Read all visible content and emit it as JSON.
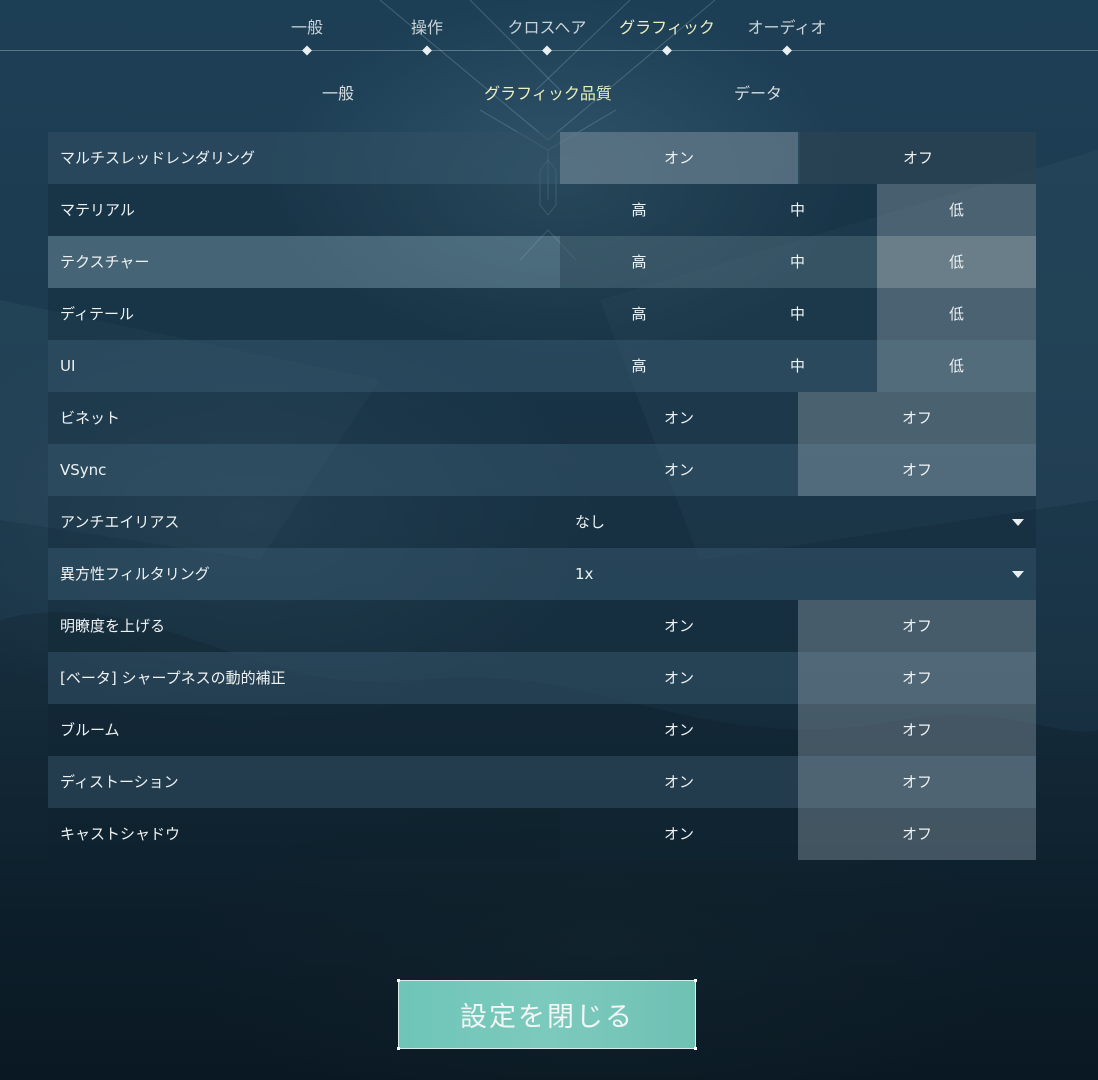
{
  "top_tabs": [
    {
      "label": "一般",
      "active": false
    },
    {
      "label": "操作",
      "active": false
    },
    {
      "label": "クロスヘア",
      "active": false
    },
    {
      "label": "グラフィック",
      "active": true
    },
    {
      "label": "オーディオ",
      "active": false
    }
  ],
  "sub_tabs": [
    {
      "label": "一般",
      "active": false
    },
    {
      "label": "グラフィック品質",
      "active": true
    },
    {
      "label": "データ",
      "active": false
    }
  ],
  "settings": [
    {
      "label": "マルチスレッドレンダリング",
      "type": "toggle",
      "options": [
        "オン",
        "オフ"
      ],
      "selected": "オン"
    },
    {
      "label": "マテリアル",
      "type": "quality",
      "options": [
        "高",
        "中",
        "低"
      ],
      "selected": "低"
    },
    {
      "label": "テクスチャー",
      "type": "quality",
      "options": [
        "高",
        "中",
        "低"
      ],
      "selected": "低"
    },
    {
      "label": "ディテール",
      "type": "quality",
      "options": [
        "高",
        "中",
        "低"
      ],
      "selected": "低"
    },
    {
      "label": "UI",
      "type": "quality",
      "options": [
        "高",
        "中",
        "低"
      ],
      "selected": "低"
    },
    {
      "label": "ビネット",
      "type": "toggle",
      "options": [
        "オン",
        "オフ"
      ],
      "selected": "オフ"
    },
    {
      "label": "VSync",
      "type": "toggle",
      "options": [
        "オン",
        "オフ"
      ],
      "selected": "オフ"
    },
    {
      "label": "アンチエイリアス",
      "type": "dropdown",
      "value": "なし"
    },
    {
      "label": "異方性フィルタリング",
      "type": "dropdown",
      "value": "1x"
    },
    {
      "label": "明瞭度を上げる",
      "type": "toggle",
      "options": [
        "オン",
        "オフ"
      ],
      "selected": "オフ"
    },
    {
      "label": "[ベータ] シャープネスの動的補正",
      "type": "toggle",
      "options": [
        "オン",
        "オフ"
      ],
      "selected": "オフ"
    },
    {
      "label": "ブルーム",
      "type": "toggle",
      "options": [
        "オン",
        "オフ"
      ],
      "selected": "オフ"
    },
    {
      "label": "ディストーション",
      "type": "toggle",
      "options": [
        "オン",
        "オフ"
      ],
      "selected": "オフ"
    },
    {
      "label": "キャストシャドウ",
      "type": "toggle",
      "options": [
        "オン",
        "オフ"
      ],
      "selected": "オフ"
    }
  ],
  "close_button": {
    "label": "設定を閉じる"
  },
  "icons": {
    "dropdown_caret": "caret-down-icon",
    "tab_marker": "diamond-icon"
  },
  "colors": {
    "accent_active_tab": "#eaeec0",
    "close_button": "#75c6b9"
  }
}
